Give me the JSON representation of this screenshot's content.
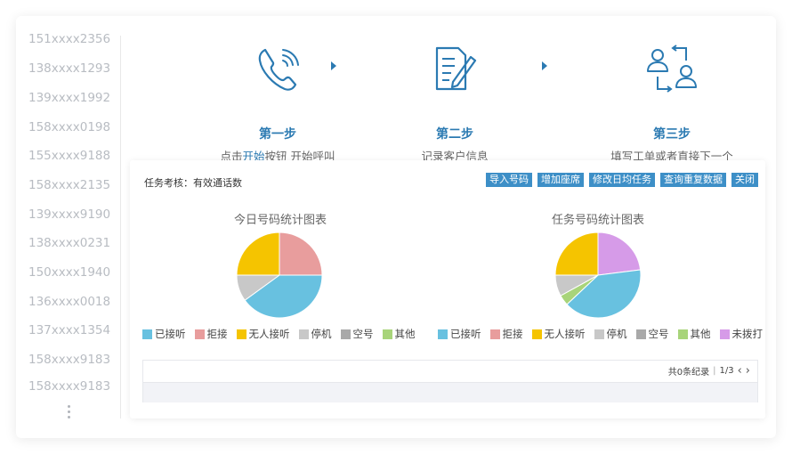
{
  "phone_numbers": [
    "151xxxx2356",
    "138xxxx1293",
    "139xxxx1992",
    "158xxxx0198",
    "155xxxx9188",
    "158xxxx2135",
    "139xxxx9190",
    "138xxxx0231",
    "150xxxx1940",
    "136xxxx0018",
    "137xxxx1354",
    "158xxxx9183",
    "158xxxx9183"
  ],
  "steps": [
    {
      "title": "第一步",
      "desc_pre": "点击",
      "desc_highlight": "开始",
      "desc_post": "按钮 开始呼叫",
      "icon": "phone-icon"
    },
    {
      "title": "第二步",
      "desc": "记录客户信息",
      "icon": "document-edit-icon"
    },
    {
      "title": "第三步",
      "desc": "填写工单或者直接下一个",
      "icon": "transfer-users-icon"
    }
  ],
  "panel": {
    "task_label": "任务考核：有效通话数",
    "buttons": [
      "导入号码",
      "增加座席",
      "修改日均任务",
      "查询重复数据",
      "关闭"
    ]
  },
  "colors": {
    "accent": "#2b7ab2",
    "button": "#3d8fc7",
    "answered": "#68c1e0",
    "rejected": "#e89d9d",
    "no_answer": "#f5c400",
    "suspended": "#c8c8c8",
    "empty": "#a9a9a9",
    "other": "#a8d47a",
    "not_dialed": "#d69be8"
  },
  "chart_data": [
    {
      "type": "pie",
      "title": "今日号码统计图表",
      "slices": [
        {
          "name": "已接听",
          "value": 40,
          "color": "#68c1e0"
        },
        {
          "name": "拒接",
          "value": 25,
          "color": "#e89d9d"
        },
        {
          "name": "无人接听",
          "value": 25,
          "color": "#f5c400"
        },
        {
          "name": "停机",
          "value": 10,
          "color": "#c8c8c8"
        },
        {
          "name": "空号",
          "value": 0,
          "color": "#a9a9a9"
        },
        {
          "name": "其他",
          "value": 0,
          "color": "#a8d47a"
        }
      ],
      "start_angle_deg": 0,
      "slice_order": [
        "拒接",
        "已接听",
        "停机",
        "无人接听"
      ],
      "legend_position": "bottom"
    },
    {
      "type": "pie",
      "title": "任务号码统计图表",
      "slices": [
        {
          "name": "已接听",
          "value": 40,
          "color": "#68c1e0"
        },
        {
          "name": "拒接",
          "value": 0,
          "color": "#e89d9d"
        },
        {
          "name": "无人接听",
          "value": 25,
          "color": "#f5c400"
        },
        {
          "name": "停机",
          "value": 8,
          "color": "#c8c8c8"
        },
        {
          "name": "空号",
          "value": 0,
          "color": "#a9a9a9"
        },
        {
          "name": "其他",
          "value": 4,
          "color": "#a8d47a"
        },
        {
          "name": "未拨打",
          "value": 23,
          "color": "#d69be8"
        }
      ],
      "start_angle_deg": 0,
      "slice_order": [
        "未拨打",
        "已接听",
        "其他",
        "停机",
        "无人接听"
      ],
      "legend_position": "bottom"
    }
  ],
  "pager": {
    "records": "共0条纪录",
    "sep": "|",
    "page": "1/3"
  }
}
